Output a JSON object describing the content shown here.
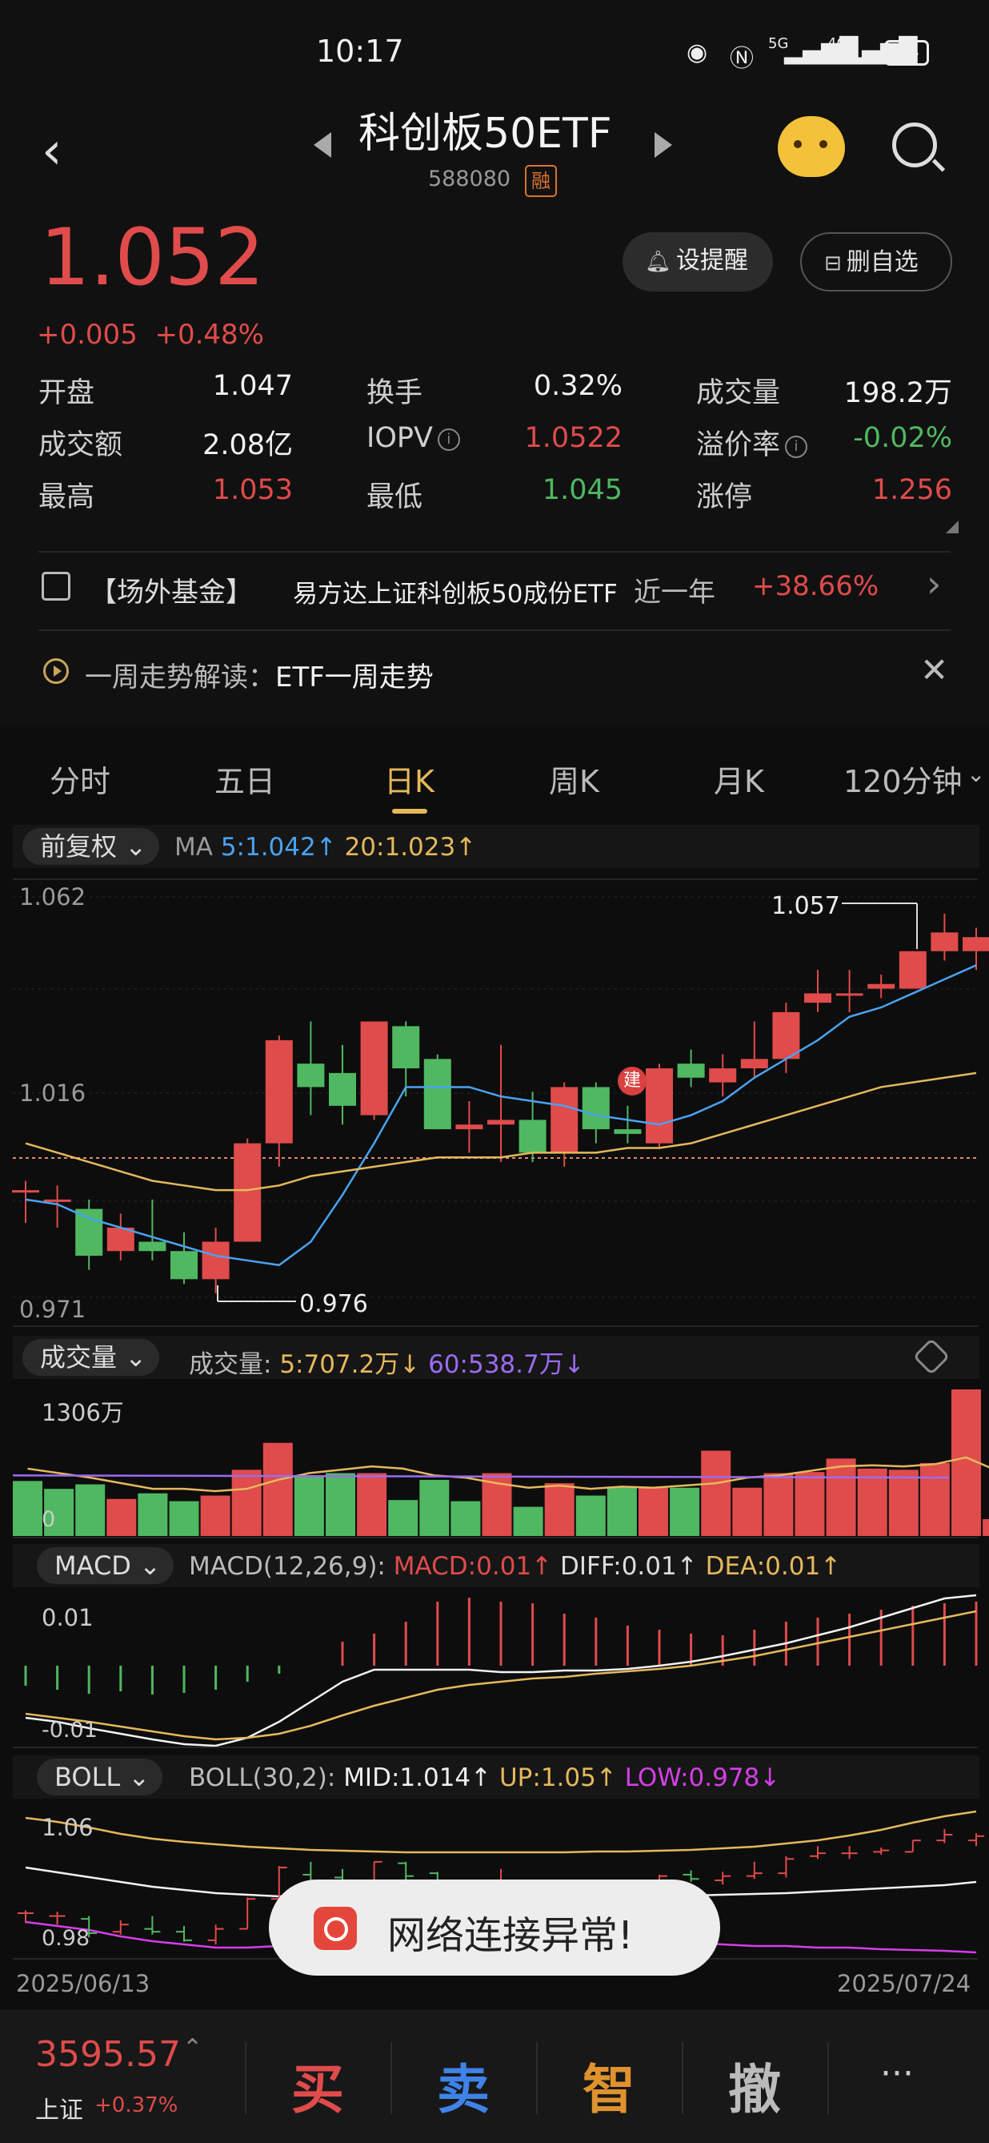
{
  "status_bar": {
    "time": "10:17",
    "battery": "84",
    "net1": "5G",
    "net2": "4G"
  },
  "header": {
    "title": "科创板50ETF",
    "code": "588080",
    "margin_badge": "融"
  },
  "quote": {
    "price": "1.052",
    "change": "+0.005",
    "change_pct": "+0.48%",
    "alarm_label": "设提醒",
    "watch_label": "删自选"
  },
  "stats": [
    {
      "label": "开盘",
      "value": "1.047",
      "color": "white"
    },
    {
      "label": "换手",
      "value": "0.32%",
      "color": "white"
    },
    {
      "label": "成交量",
      "value": "198.2万",
      "color": "white"
    },
    {
      "label": "成交额",
      "value": "2.08亿",
      "color": "white"
    },
    {
      "label": "IOPV",
      "value": "1.0522",
      "color": "red",
      "info": true
    },
    {
      "label": "溢价率",
      "value": "-0.02%",
      "color": "green",
      "info": true
    },
    {
      "label": "最高",
      "value": "1.053",
      "color": "red"
    },
    {
      "label": "最低",
      "value": "1.045",
      "color": "green"
    },
    {
      "label": "涨停",
      "value": "1.256",
      "color": "red"
    }
  ],
  "fund": {
    "tag": "【场外基金】",
    "name": "易方达上证科创板50成份ETF",
    "period": "近一年",
    "return": "+38.66%"
  },
  "trend": {
    "label": "一周走势解读：",
    "value": "ETF一周走势"
  },
  "tabs": [
    "分时",
    "五日",
    "日K",
    "周K",
    "月K",
    "120分钟"
  ],
  "kline": {
    "adjust": "前复权",
    "ma_label": "MA",
    "ma5": "5:1.042",
    "ma20": "20:1.023",
    "y_top": "1.062",
    "y_mid": "1.016",
    "y_bot": "0.971",
    "max_label": "1.057",
    "min_label": "0.976",
    "marker": "建"
  },
  "volume": {
    "selector": "成交量",
    "title": "成交量:",
    "ma5": "5:707.2万",
    "ma60": "60:538.7万",
    "y_top": "1306万",
    "y_bot": "0"
  },
  "macd": {
    "selector": "MACD",
    "params": "MACD(12,26,9):",
    "macd": "MACD:0.01",
    "diff": "DIFF:0.01",
    "dea": "DEA:0.01",
    "y_top": "0.01",
    "y_bot": "-0.01"
  },
  "boll": {
    "selector": "BOLL",
    "params": "BOLL(30,2):",
    "mid": "MID:1.014",
    "up": "UP:1.05",
    "low": "LOW:0.978",
    "y_top": "1.06",
    "y_bot": "0.98"
  },
  "dates": {
    "start": "2025/06/13",
    "end": "2025/07/24"
  },
  "toast": "网络连接异常!",
  "bottom": {
    "index_value": "3595.57",
    "index_name": "上证",
    "index_pct": "+0.37%",
    "buy": "买",
    "sell": "卖",
    "smart": "智",
    "cancel": "撤",
    "more": "···"
  },
  "colors": {
    "up": "#e04b4b",
    "down": "#4fb861",
    "ma5": "#4aa3f0",
    "ma20": "#e6b85c",
    "vol_ma60": "#9b6cf0",
    "boll_low": "#d63ee8"
  },
  "chart_data": {
    "type": "candlestick",
    "dates": {
      "start": "2025/06/13",
      "end": "2025/07/24"
    },
    "candles": [
      {
        "o": 0.998,
        "h": 1.0,
        "l": 0.991,
        "c": 0.998
      },
      {
        "o": 0.996,
        "h": 0.999,
        "l": 0.99,
        "c": 0.996
      },
      {
        "o": 0.994,
        "h": 0.996,
        "l": 0.981,
        "c": 0.984
      },
      {
        "o": 0.985,
        "h": 0.993,
        "l": 0.983,
        "c": 0.99
      },
      {
        "o": 0.987,
        "h": 0.996,
        "l": 0.983,
        "c": 0.985
      },
      {
        "o": 0.985,
        "h": 0.989,
        "l": 0.978,
        "c": 0.979
      },
      {
        "o": 0.979,
        "h": 0.99,
        "l": 0.976,
        "c": 0.987
      },
      {
        "o": 0.987,
        "h": 1.009,
        "l": 0.987,
        "c": 1.008
      },
      {
        "o": 1.008,
        "h": 1.031,
        "l": 1.003,
        "c": 1.03
      },
      {
        "o": 1.025,
        "h": 1.034,
        "l": 1.014,
        "c": 1.02
      },
      {
        "o": 1.023,
        "h": 1.029,
        "l": 1.012,
        "c": 1.016
      },
      {
        "o": 1.014,
        "h": 1.034,
        "l": 1.013,
        "c": 1.034
      },
      {
        "o": 1.033,
        "h": 1.034,
        "l": 1.018,
        "c": 1.024
      },
      {
        "o": 1.026,
        "h": 1.027,
        "l": 1.011,
        "c": 1.011
      },
      {
        "o": 1.011,
        "h": 1.017,
        "l": 1.006,
        "c": 1.012
      },
      {
        "o": 1.012,
        "h": 1.029,
        "l": 1.004,
        "c": 1.013
      },
      {
        "o": 1.013,
        "h": 1.019,
        "l": 1.004,
        "c": 1.006
      },
      {
        "o": 1.006,
        "h": 1.021,
        "l": 1.003,
        "c": 1.02
      },
      {
        "o": 1.02,
        "h": 1.021,
        "l": 1.008,
        "c": 1.011
      },
      {
        "o": 1.011,
        "h": 1.016,
        "l": 1.008,
        "c": 1.01
      },
      {
        "o": 1.008,
        "h": 1.025,
        "l": 1.007,
        "c": 1.024
      },
      {
        "o": 1.025,
        "h": 1.028,
        "l": 1.02,
        "c": 1.022
      },
      {
        "o": 1.021,
        "h": 1.027,
        "l": 1.018,
        "c": 1.024
      },
      {
        "o": 1.024,
        "h": 1.034,
        "l": 1.022,
        "c": 1.026
      },
      {
        "o": 1.026,
        "h": 1.038,
        "l": 1.023,
        "c": 1.036
      },
      {
        "o": 1.038,
        "h": 1.045,
        "l": 1.036,
        "c": 1.04
      },
      {
        "o": 1.04,
        "h": 1.045,
        "l": 1.036,
        "c": 1.04
      },
      {
        "o": 1.041,
        "h": 1.044,
        "l": 1.039,
        "c": 1.042
      },
      {
        "o": 1.041,
        "h": 1.049,
        "l": 1.041,
        "c": 1.049
      },
      {
        "o": 1.049,
        "h": 1.057,
        "l": 1.047,
        "c": 1.053
      },
      {
        "o": 1.049,
        "h": 1.054,
        "l": 1.045,
        "c": 1.052
      }
    ],
    "ma5": [
      0.996,
      0.995,
      0.992,
      0.99,
      0.988,
      0.986,
      0.984,
      0.983,
      0.982,
      0.987,
      0.997,
      1.008,
      1.02,
      1.02,
      1.02,
      1.018,
      1.017,
      1.016,
      1.014,
      1.013,
      1.012,
      1.014,
      1.017,
      1.022,
      1.026,
      1.03,
      1.035,
      1.037,
      1.04,
      1.043,
      1.046
    ],
    "ma20": [
      1.008,
      1.006,
      1.004,
      1.002,
      1.0,
      0.999,
      0.998,
      0.998,
      0.999,
      1.001,
      1.002,
      1.003,
      1.004,
      1.005,
      1.005,
      1.005,
      1.006,
      1.006,
      1.006,
      1.007,
      1.007,
      1.008,
      1.01,
      1.012,
      1.014,
      1.016,
      1.018,
      1.02,
      1.021,
      1.022,
      1.023
    ],
    "volume_wan": [
      490,
      420,
      460,
      330,
      380,
      310,
      360,
      590,
      830,
      540,
      560,
      560,
      320,
      500,
      310,
      560,
      260,
      470,
      360,
      440,
      430,
      430,
      760,
      430,
      560,
      570,
      690,
      600,
      590,
      650,
      1306,
      150
    ],
    "volume_up": [
      false,
      false,
      false,
      true,
      false,
      false,
      true,
      true,
      true,
      false,
      false,
      true,
      false,
      false,
      false,
      true,
      false,
      true,
      false,
      false,
      true,
      false,
      true,
      true,
      true,
      true,
      true,
      true,
      true,
      true,
      true,
      true
    ]
  }
}
